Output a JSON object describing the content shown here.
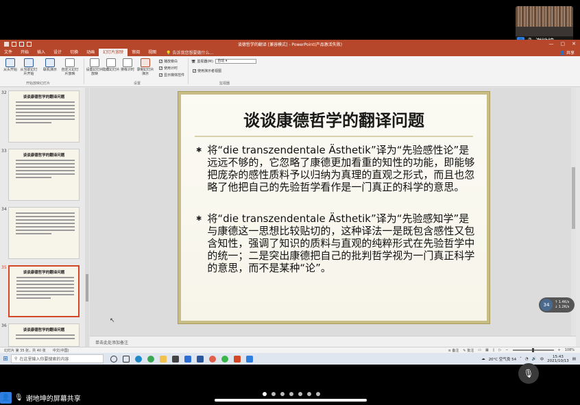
{
  "window": {
    "title": "谈德哲学的翻译 [兼容模式] - PowerPoint(产品激活失败)",
    "share_label": "共享"
  },
  "tabs": [
    {
      "label": "文件",
      "active": false
    },
    {
      "label": "开始",
      "active": false
    },
    {
      "label": "插入",
      "active": false
    },
    {
      "label": "设计",
      "active": false
    },
    {
      "label": "切换",
      "active": false
    },
    {
      "label": "动画",
      "active": false
    },
    {
      "label": "幻灯片放映",
      "active": true
    },
    {
      "label": "审阅",
      "active": false
    },
    {
      "label": "视图",
      "active": false
    }
  ],
  "tell_me": "告诉我您想要做什么...",
  "ribbon": {
    "buttons": [
      {
        "label": "从头开始"
      },
      {
        "label": "从当前幻灯片开始"
      },
      {
        "label": "联机演示"
      },
      {
        "label": "自定义幻灯片放映"
      },
      {
        "label": "设置幻灯片放映"
      },
      {
        "label": "隐藏幻灯片"
      },
      {
        "label": "排练计时"
      },
      {
        "label": "录制幻灯片演示"
      }
    ],
    "groups": {
      "start": "开始放映幻灯片",
      "setup": "设置",
      "monitors": "监视器"
    },
    "checkboxes": {
      "narration": "播放旁白",
      "timings": "使用计时",
      "media_controls": "显示媒体控件",
      "presenter_view": "使用演示者视图"
    },
    "monitor": {
      "label": "监视器(M):",
      "value": "自动"
    }
  },
  "thumbnails": [
    {
      "num": "32",
      "title": "谈谈康德哲学的翻译问题"
    },
    {
      "num": "33",
      "title": "谈谈康德哲学的翻译问题"
    },
    {
      "num": "34",
      "title": ""
    },
    {
      "num": "35",
      "title": "谈谈康德哲学的翻译问题"
    },
    {
      "num": "36",
      "title": "谈谈康德哲学的翻译问题"
    }
  ],
  "slide": {
    "title": "谈谈康德哲学的翻译问题",
    "bullets": [
      "将“die transzendentale Ästhetik”译为“先验感性论”是远远不够的，它忽略了康德更加看重的知性的功能，即能够把庞杂的感性质料予以归纳为真理的直观之形式，而且也忽略了他把自己的先验哲学看作是一门真正的科学的意思。",
      "将“die transzendentale Ästhetik”译为“先验感知学”是与康德这一思想比较贴切的，这种译法一是既包含感性又包含知性，强调了知识的质料与直观的纯粹形式在先验哲学中的统一；二是突出康德把自己的批判哲学视为一门真正科学的意思，而不是某种“论”。"
    ]
  },
  "notes_placeholder": "单击此处添加备注",
  "status": {
    "slide_info": "幻灯片 第 35 张，共 40 张",
    "lang": "中文(中国)",
    "notes": "备注",
    "comments": "批注",
    "zoom": "108%"
  },
  "taskbar": {
    "search_placeholder": "在这里输入你要搜索的内容",
    "weather": "20°C 空气良 54",
    "lang": "中",
    "time": "15:43",
    "date": "2021/10/13"
  },
  "speed_overlay": {
    "value": "34",
    "up": "1.4K/s",
    "down": "1.2K/s"
  },
  "participant": {
    "name": "谢地坤"
  },
  "screen_share_label": "谢地坤的屏幕共享",
  "colors": {
    "accent": "#b7472a",
    "slide_border": "#c9bd86"
  }
}
